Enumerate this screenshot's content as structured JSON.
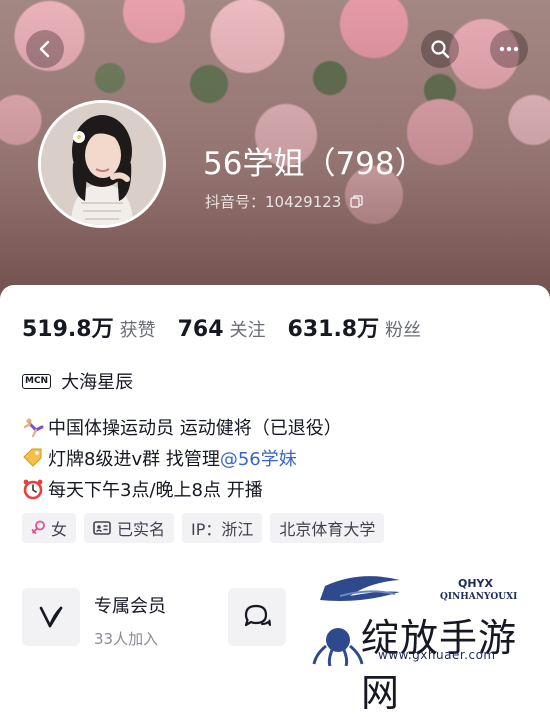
{
  "profile": {
    "nickname": "56学姐（798）",
    "douyin_id": "抖音号：10429123"
  },
  "stats": [
    {
      "value": "519.8万",
      "label": "获赞"
    },
    {
      "value": "764",
      "label": "关注"
    },
    {
      "value": "631.8万",
      "label": "粉丝"
    }
  ],
  "mcn": {
    "badge": "MCN",
    "name": "大海星辰"
  },
  "bio": {
    "line1": "中国体操运动员 运动健将（已退役）",
    "line2_prefix": "灯牌8级进v群 找管理",
    "line2_mention": "@56学妹",
    "line3": "每天下午3点/晚上8点 开播"
  },
  "tags": [
    {
      "label": "女"
    },
    {
      "label": "已实名"
    },
    {
      "label": "IP：浙江"
    },
    {
      "label": "北京体育大学"
    }
  ],
  "member": {
    "title": "专属会员",
    "count": "33人加入"
  },
  "watermark": {
    "text": "绽放手游网",
    "sub": "www.gxhuaer.com",
    "logo": "QHYX",
    "logo_sub": "QINHANYOUXI"
  },
  "colors": {
    "mention": "#3b64c8",
    "tag_bg": "#f2f2f4"
  },
  "icons": [
    "back-arrow-icon",
    "search-icon",
    "more-icon",
    "copy-icon",
    "female-icon",
    "id-card-icon",
    "v-member-icon",
    "chat-icon"
  ]
}
